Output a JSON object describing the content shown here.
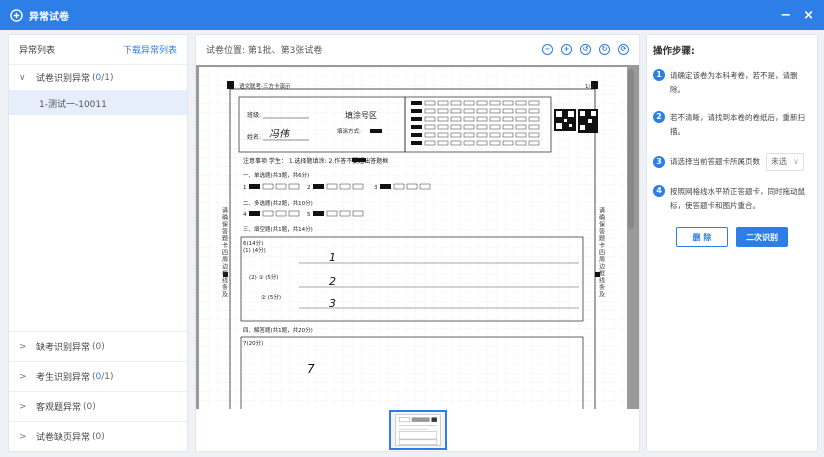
{
  "window": {
    "title": "异常试卷",
    "minimize": "−",
    "close": "×"
  },
  "left": {
    "header": "异常列表",
    "download_link": "下载异常列表",
    "groups": [
      {
        "label": "试卷识别异常",
        "count_prefix": "(",
        "count_current": "0",
        "count_suffix": "/1)",
        "expanded": true
      },
      {
        "label": "缺考识别异常",
        "count": "(0)"
      },
      {
        "label": "考生识别异常",
        "count_prefix": "(",
        "count_current": "0",
        "count_suffix": "/1)"
      },
      {
        "label": "客观题异常",
        "count": "(0)"
      },
      {
        "label": "试卷缺页异常",
        "count": "(0)"
      }
    ],
    "sub_item": "1-测试一-10011"
  },
  "center": {
    "location": "试卷位置: 第1批、第3张试卷",
    "sheet": {
      "top_text": "语文联考-三方卡演示",
      "page_num": "1/1",
      "class_label": "班级:",
      "name_label": "姓名:",
      "name_value": "冯伟",
      "exam_no_label": "填涂号区",
      "fill_method_label": "填涂方式:",
      "notice": "注意事项  学生：  1.选择题填涂:      2.作答不要超出答题框",
      "sec1": "一、单选题(共3题，共6分)",
      "sec2": "二、多选题(共2题，共10分)",
      "sec3": "三、填空题(共1题，共14分)",
      "sec3_q": "6(14分)",
      "sec3_q1": "(1) (4分)",
      "sec3_q2": "(2) ① (5分)",
      "sec3_q3": "② (5分)",
      "ans1": "1",
      "ans2": "2",
      "ans3": "3",
      "sec4": "四、解答题(共1题，共20分)",
      "sec4_q": "7(20分)",
      "ans4": "7",
      "side_left": "请确保答题卡四周边框线条及",
      "side_right": "请确保答题卡四周边框线条及",
      "q_nums_1": [
        "1",
        "2",
        "3"
      ],
      "q_nums_2": [
        "4",
        "5"
      ]
    }
  },
  "right": {
    "title": "操作步骤:",
    "steps": [
      {
        "n": "1",
        "text": "请确定该卷为本科考卷，若不是，请删除。"
      },
      {
        "n": "2",
        "text": "若不清晰，请找到本卷的卷纸后，重新扫描。"
      },
      {
        "n": "3",
        "text": "请选择当前答题卡所属页数",
        "select": "未选"
      },
      {
        "n": "4",
        "text": "按照网格线水平矫正答题卡，同时拖动鼠标，使答题卡和图片重合。"
      }
    ],
    "delete_label": "删 除",
    "rerecognize_label": "二次识别"
  }
}
